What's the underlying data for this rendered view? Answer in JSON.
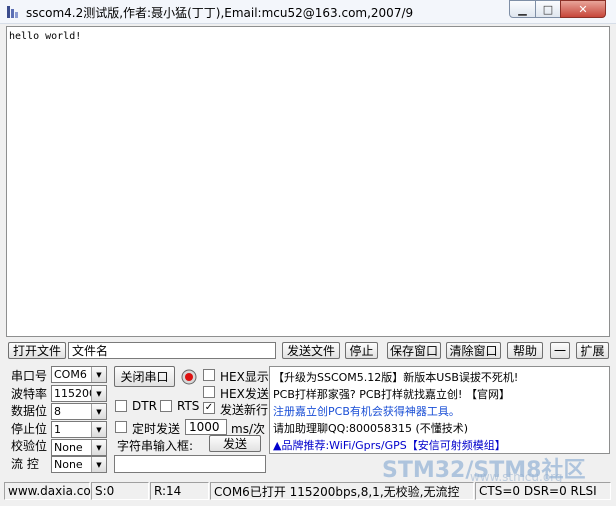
{
  "window": {
    "title": "sscom4.2测试版,作者:聂小猛(丁丁),Email:mcu52@163.com,2007/9",
    "min_glyph": "▁",
    "max_glyph": "□",
    "close_glyph": "✕"
  },
  "receive": {
    "text": "hello world!"
  },
  "toolbar": {
    "open_file": "打开文件",
    "filename": "文件名",
    "send_file": "发送文件",
    "stop": "停止",
    "save_window": "保存窗口",
    "clear_window": "清除窗口",
    "help": "帮助",
    "collapse": "一",
    "expand": "扩展"
  },
  "serial": {
    "port_label": "串口号",
    "port_value": "COM6",
    "baud_label": "波特率",
    "baud_value": "115200",
    "databits_label": "数据位",
    "databits_value": "8",
    "stopbits_label": "停止位",
    "stopbits_value": "1",
    "parity_label": "校验位",
    "parity_value": "None",
    "flow_label": "流 控",
    "flow_value": "None"
  },
  "controls": {
    "close_port": "关闭串口",
    "hex_display": "HEX显示",
    "hex_send": "HEX发送",
    "send_newline": "发送新行",
    "dtr": "DTR",
    "rts": "RTS",
    "timed_send": "定时发送",
    "interval": "1000",
    "interval_unit": "ms/次",
    "string_input_label": "字符串输入框:",
    "send": "发送",
    "send_input": ""
  },
  "checkbox_states": {
    "hex_display": false,
    "hex_send": false,
    "send_newline": true,
    "dtr": false,
    "rts": false,
    "timed_send": false
  },
  "info": {
    "line1": "【升级为SSCOM5.12版】新版本USB误拔不死机!",
    "line2": "PCB打样那家强? PCB打样就找嘉立创! 【官网】",
    "line3": "注册嘉立创PCB有机会获得神器工具。",
    "line4": "请加助理聊QQ:800058315 (不懂技术)",
    "line5": "▲品牌推荐:WiFi/Gprs/GPS【安信可射频模组】"
  },
  "watermark": {
    "text": "STM32/STM8社区",
    "url": "www.stmcu.org"
  },
  "status": {
    "website": "www.daxia.cor",
    "sent": "S:0",
    "received": "R:14",
    "port_status": "COM6已打开  115200bps,8,1,无校验,无流控",
    "signals": "CTS=0 DSR=0 RLSI"
  },
  "colors": {
    "info_blue": "#0000cc",
    "info_red": "#cc0000",
    "info_line3": "#1a4fd6"
  }
}
